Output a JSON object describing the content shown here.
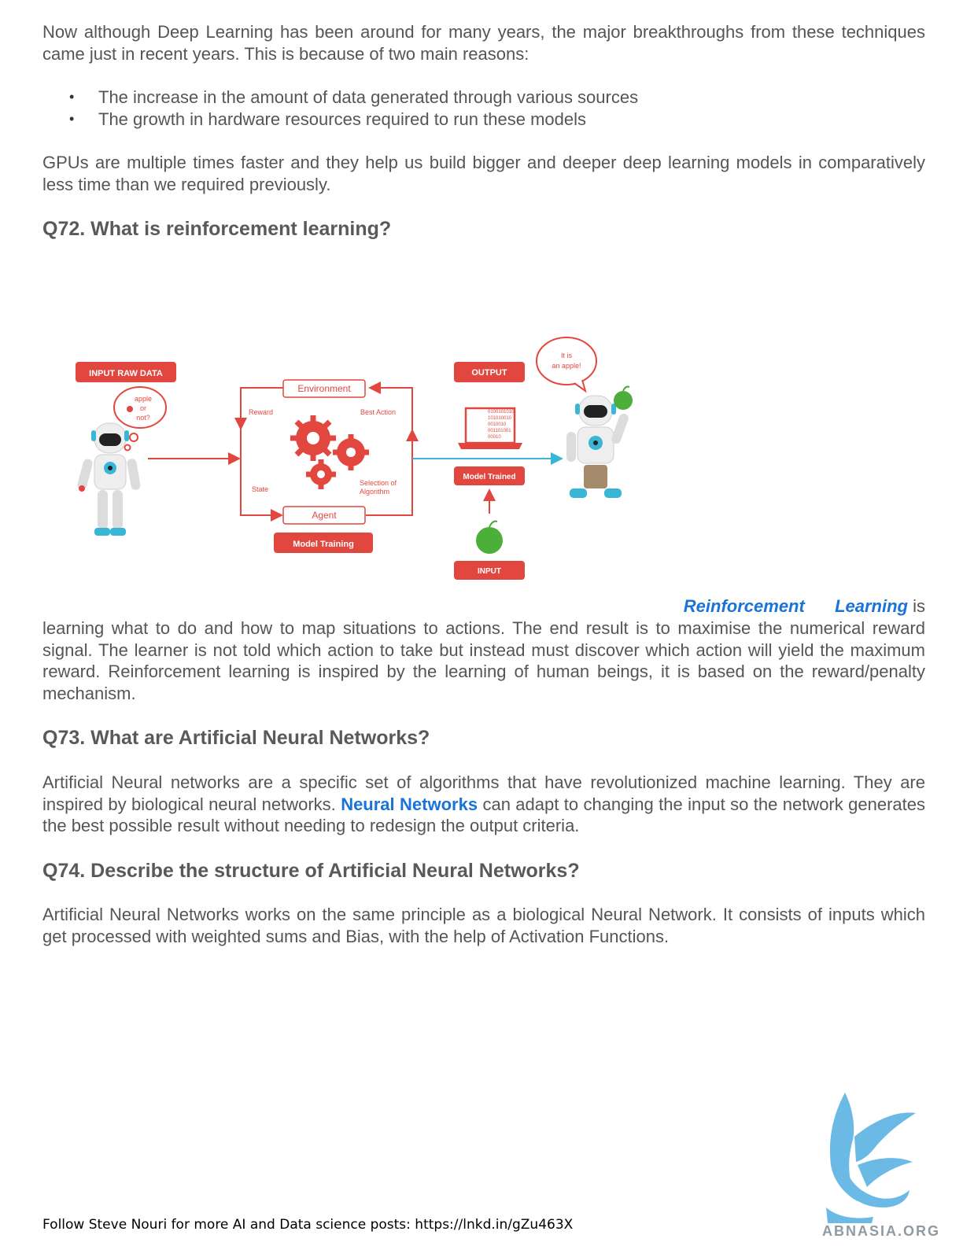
{
  "intro": {
    "paragraph1": "Now although Deep Learning has been around for many years, the major breakthroughs from these techniques came just in recent years. This is because of two main reasons:",
    "bullets": [
      "The increase in the amount of data generated through various sources",
      "The growth in hardware resources required to run these models"
    ],
    "paragraph2": "GPUs are multiple times faster and they help us build bigger and deeper deep learning models in comparatively less time than we required previously."
  },
  "q72": {
    "heading": "Q72. What is reinforcement learning?",
    "link_word1": "Reinforcement",
    "link_word2": "Learning",
    "is_word": "is",
    "body": "learning what to do and how to map situations to actions. The end result is to maximise the numerical reward signal. The learner is not told which action to take but instead must discover which action will yield the maximum reward. Reinforcement learning is inspired by the learning of human beings, it is based on the reward/penalty mechanism."
  },
  "diagram": {
    "input_raw_data": "INPUT RAW DATA",
    "thought_apple": [
      "apple",
      "or",
      "not?"
    ],
    "environment": "Environment",
    "reward": "Reward",
    "best_action": "Best Action",
    "state": "State",
    "selection_of_algorithm": [
      "Selection of",
      "Algorithm"
    ],
    "agent": "Agent",
    "model_training": "Model Training",
    "output": "OUTPUT",
    "binary_lines": [
      "0100101010",
      "101010010",
      "0010010",
      "001101001",
      "00010"
    ],
    "model_trained": "Model Trained",
    "input": "INPUT",
    "speech": [
      "It is",
      "an apple!"
    ],
    "accent_color": "#e2473f",
    "robot_accent": "#39b6d6",
    "apple_color": "#4caf3a"
  },
  "q73": {
    "heading": "Q73. What are Artificial Neural Networks?",
    "body_before": "Artificial Neural networks are a specific set of algorithms that have revolutionized machine learning. They are inspired by biological neural networks.",
    "link": "Neural Networks",
    "body_after": "can adapt to changing the input so the network generates the best possible result without needing to redesign the output criteria."
  },
  "q74": {
    "heading": "Q74. Describe the structure of Artificial Neural Networks?",
    "body": "Artificial Neural Networks works on the same principle as a biological Neural Network. It consists of inputs which get processed with weighted sums and Bias, with the help of Activation Functions."
  },
  "logo": {
    "text": "ABNASIA.ORG",
    "color": "#5bb2e3"
  },
  "footer": "Follow Steve Nouri for more AI and Data science posts: https://lnkd.in/gZu463X",
  "colors": {
    "text": "#555555",
    "link": "#1a73d6"
  }
}
